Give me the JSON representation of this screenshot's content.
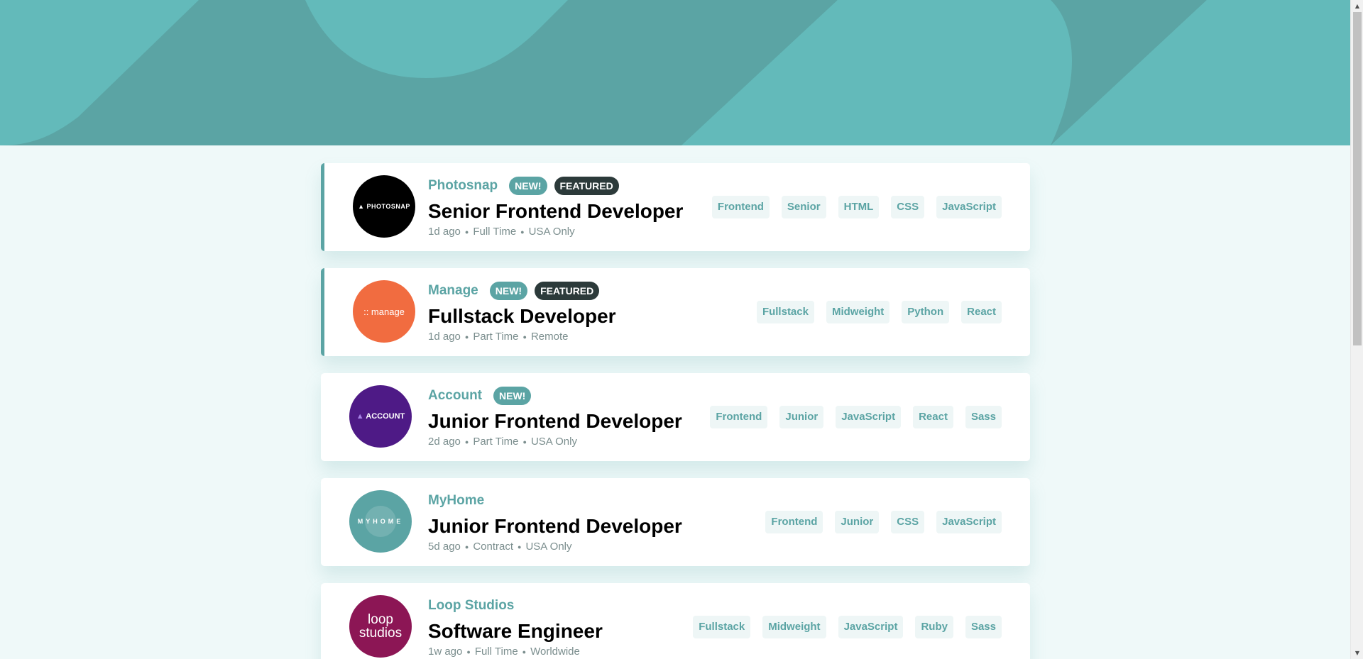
{
  "colors": {
    "primary": "#5ba4a4",
    "background": "#eff9f9",
    "dark": "#2c3a3a",
    "tag_bg": "#eef6f6"
  },
  "jobs": [
    {
      "company": "Photosnap",
      "logo_text": "PHOTOSNAP",
      "logo_color": "#000000",
      "new_label": "NEW!",
      "featured_label": "FEATURED",
      "position": "Senior Frontend Developer",
      "posted": "1d ago",
      "contract": "Full Time",
      "location": "USA Only",
      "tags": [
        "Frontend",
        "Senior",
        "HTML",
        "CSS",
        "JavaScript"
      ]
    },
    {
      "company": "Manage",
      "logo_text": "manage",
      "logo_color": "#f16c40",
      "new_label": "NEW!",
      "featured_label": "FEATURED",
      "position": "Fullstack Developer",
      "posted": "1d ago",
      "contract": "Part Time",
      "location": "Remote",
      "tags": [
        "Fullstack",
        "Midweight",
        "Python",
        "React"
      ]
    },
    {
      "company": "Account",
      "logo_text": "ACCOUNT",
      "logo_color": "#4e1a86",
      "new_label": "NEW!",
      "position": "Junior Frontend Developer",
      "posted": "2d ago",
      "contract": "Part Time",
      "location": "USA Only",
      "tags": [
        "Frontend",
        "Junior",
        "JavaScript",
        "React",
        "Sass"
      ]
    },
    {
      "company": "MyHome",
      "logo_text": "MYHOME",
      "logo_color": "#5ba4a4",
      "position": "Junior Frontend Developer",
      "posted": "5d ago",
      "contract": "Contract",
      "location": "USA Only",
      "tags": [
        "Frontend",
        "Junior",
        "CSS",
        "JavaScript"
      ]
    },
    {
      "company": "Loop Studios",
      "logo_text_1": "loop",
      "logo_text_2": "studios",
      "logo_color": "#8c1655",
      "position": "Software Engineer",
      "posted": "1w ago",
      "contract": "Full Time",
      "location": "Worldwide",
      "tags": [
        "Fullstack",
        "Midweight",
        "JavaScript",
        "Ruby",
        "Sass"
      ]
    }
  ]
}
